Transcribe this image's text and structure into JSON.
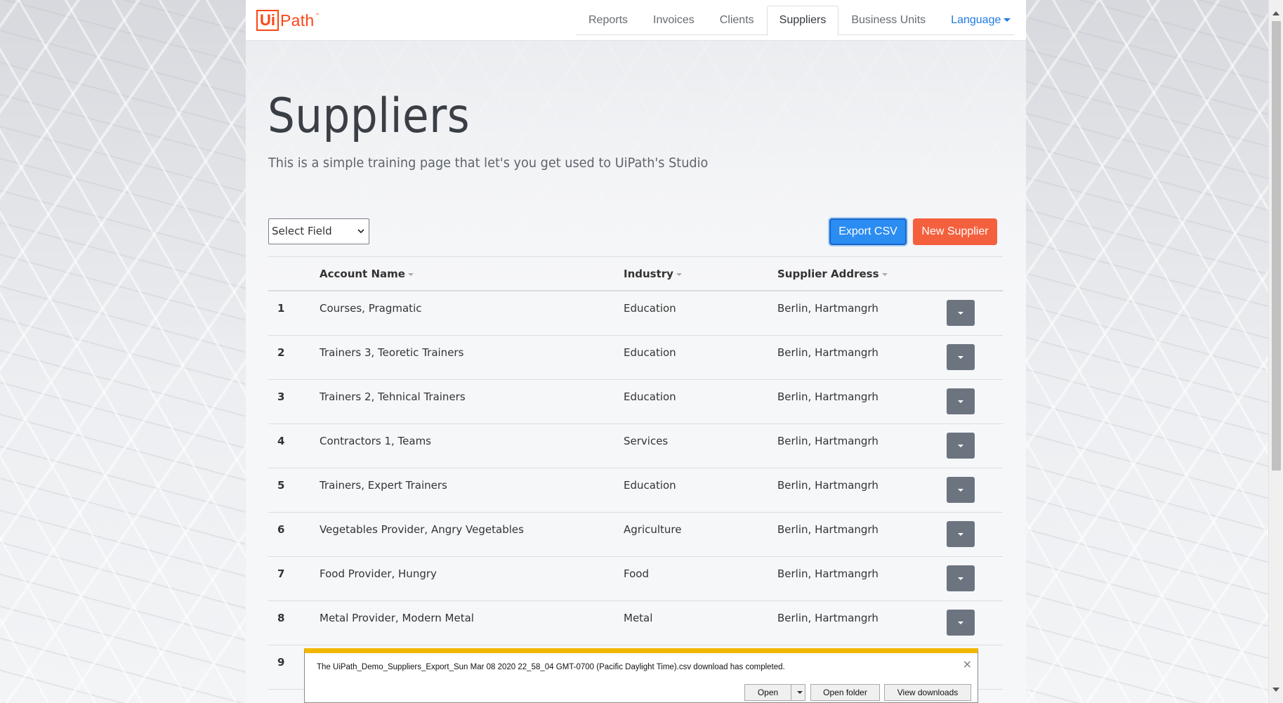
{
  "logo": {
    "box_text": "Ui",
    "text": "Path",
    "tm": "™"
  },
  "nav": {
    "tabs": [
      {
        "label": "Reports"
      },
      {
        "label": "Invoices"
      },
      {
        "label": "Clients"
      },
      {
        "label": "Suppliers",
        "active": true
      },
      {
        "label": "Business Units"
      }
    ],
    "language_label": "Language"
  },
  "page": {
    "title": "Suppliers",
    "subtitle": "This is a simple training page that let's you get used to UiPath's Studio"
  },
  "filter": {
    "select_value": "Select Field"
  },
  "actions": {
    "export_label": "Export CSV",
    "new_label": "New Supplier"
  },
  "table": {
    "headers": {
      "account": "Account Name",
      "industry": "Industry",
      "address": "Supplier Address"
    },
    "rows": [
      {
        "num": "1",
        "account": "Courses, Pragmatic",
        "industry": "Education",
        "address": "Berlin, Hartmangrh"
      },
      {
        "num": "2",
        "account": "Trainers 3, Teoretic Trainers",
        "industry": "Education",
        "address": "Berlin, Hartmangrh"
      },
      {
        "num": "3",
        "account": "Trainers 2, Tehnical Trainers",
        "industry": "Education",
        "address": "Berlin, Hartmangrh"
      },
      {
        "num": "4",
        "account": "Contractors 1, Teams",
        "industry": "Services",
        "address": "Berlin, Hartmangrh"
      },
      {
        "num": "5",
        "account": "Trainers, Expert Trainers",
        "industry": "Education",
        "address": "Berlin, Hartmangrh"
      },
      {
        "num": "6",
        "account": "Vegetables Provider, Angry Vegetables",
        "industry": "Agriculture",
        "address": "Berlin, Hartmangrh"
      },
      {
        "num": "7",
        "account": "Food Provider, Hungry",
        "industry": "Food",
        "address": "Berlin, Hartmangrh"
      },
      {
        "num": "8",
        "account": "Metal Provider, Modern Metal",
        "industry": "Metal",
        "address": "Berlin, Hartmangrh"
      },
      {
        "num": "9",
        "account": "",
        "industry": "",
        "address": ""
      }
    ]
  },
  "download_bar": {
    "message": "The UiPath_Demo_Suppliers_Export_Sun Mar 08 2020 22_58_04 GMT-0700 (Pacific Daylight Time).csv download has completed.",
    "close_glyph": "×",
    "open_label": "Open",
    "open_folder_label": "Open folder",
    "view_downloads_label": "View downloads"
  },
  "colors": {
    "brand": "#fa4616",
    "export_button": "#2b8cf2",
    "new_button": "#f4603e",
    "language_link": "#1f7ae0",
    "download_bar_accent": "#f1b600"
  }
}
